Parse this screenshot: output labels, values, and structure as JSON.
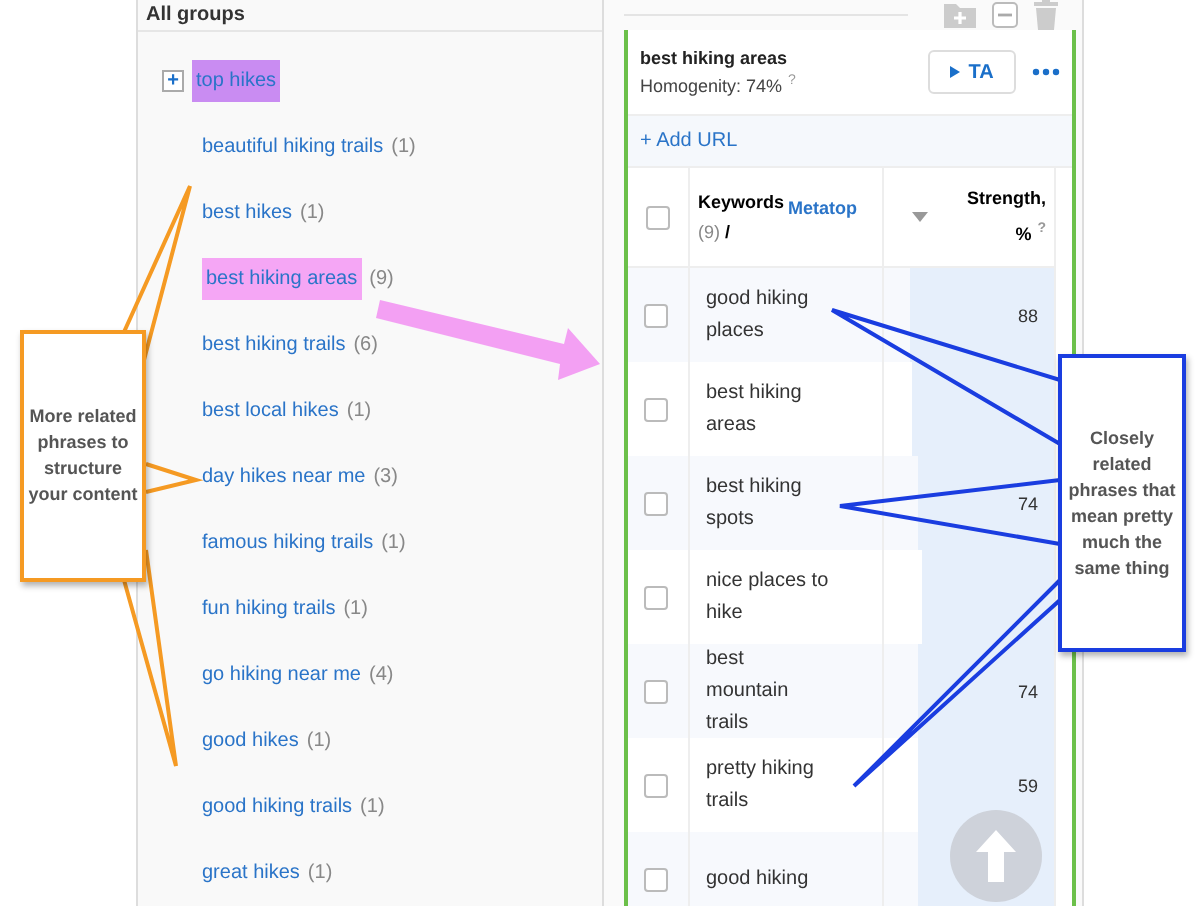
{
  "groups_panel": {
    "title": "All groups",
    "root": {
      "label": "top hikes",
      "expand_symbol": "+",
      "color": "#c98cf2"
    },
    "items": [
      {
        "label": "beautiful hiking trails",
        "count": "(1)"
      },
      {
        "label": "best hikes",
        "count": "(1)"
      },
      {
        "label": "best hiking areas",
        "count": "(9)",
        "color": "#f5a6f5"
      },
      {
        "label": "best hiking trails",
        "count": "(6)"
      },
      {
        "label": "best local hikes",
        "count": "(1)"
      },
      {
        "label": "day hikes near me",
        "count": "(3)"
      },
      {
        "label": "famous hiking trails",
        "count": "(1)"
      },
      {
        "label": "fun hiking trails",
        "count": "(1)"
      },
      {
        "label": "go hiking near me",
        "count": "(4)"
      },
      {
        "label": "good hikes",
        "count": "(1)"
      },
      {
        "label": "good hiking trails",
        "count": "(1)"
      },
      {
        "label": "great hikes",
        "count": "(1)"
      }
    ]
  },
  "group_card": {
    "title": "best hiking areas",
    "homogenity": "Homogenity: 74%",
    "help": "?",
    "ta_button": "TA",
    "add_url": "+ Add URL",
    "columns": {
      "select_all_checked": false,
      "keywords": "Keywords",
      "count": "(9)",
      "slash": "/",
      "metatop": "Metatop",
      "strength": "Strength,",
      "unit": "%",
      "help": "?"
    },
    "rows": [
      {
        "keyword": "good hiking places",
        "strength": "88",
        "level": 0.85,
        "checked": false
      },
      {
        "keyword": "best hiking areas",
        "level": 0.83,
        "checked": false
      },
      {
        "keyword": "best hiking spots",
        "strength": "74",
        "level": 0.8,
        "checked": false
      },
      {
        "keyword": "nice places to hike",
        "level": 0.78,
        "checked": false
      },
      {
        "keyword": "best mountain trails",
        "strength": "74",
        "level": 0.8,
        "checked": false
      },
      {
        "keyword": "pretty hiking trails",
        "strength": "59",
        "level": 0.8,
        "checked": false
      },
      {
        "keyword": "good hiking",
        "level": 0.8,
        "checked": false
      }
    ]
  },
  "annotations": [
    {
      "kind": "orange",
      "text": "More related phrases to structure your content"
    },
    {
      "kind": "blue",
      "text": "Closely related phrases that mean pretty much the same thing"
    }
  ]
}
